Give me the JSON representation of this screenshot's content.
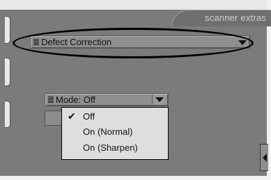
{
  "panel": {
    "extras_tab_label": "scanner extras"
  },
  "defect_section": {
    "label": "Defect Correction",
    "grip_icon": "grip-lines-icon",
    "arrow_icon": "triangle-down-icon"
  },
  "mode_select": {
    "label": "Mode: Off",
    "grip_icon": "grip-lines-icon",
    "arrow_icon": "triangle-down-icon",
    "selected": "Off"
  },
  "dropdown": {
    "items": [
      {
        "label": "Off",
        "checked": true
      },
      {
        "label": "On (Normal)",
        "checked": false
      },
      {
        "label": "On (Sharpen)",
        "checked": false
      }
    ],
    "check_glyph": "✔"
  },
  "side_tab": {
    "icon": "triangle-left-icon"
  },
  "colors": {
    "panel_bg": "#7b7b7b",
    "menu_bg": "#dedede",
    "tab_label": "#cfcfcf",
    "highlight_ellipse": "#000000"
  }
}
